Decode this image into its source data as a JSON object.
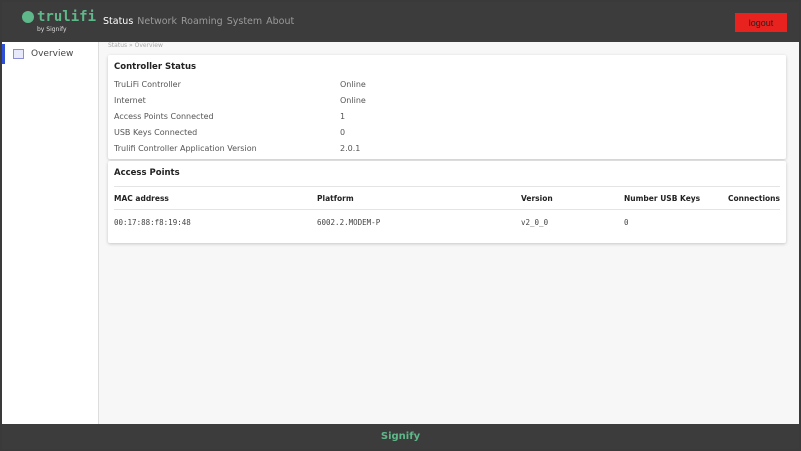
{
  "header": {
    "brand": "trulifi",
    "by": "by Signify",
    "nav": [
      "Status",
      "Network",
      "Roaming",
      "System",
      "About"
    ],
    "logout": "logout"
  },
  "sidebar": {
    "items": [
      {
        "label": "Overview"
      }
    ]
  },
  "breadcrumb": "Status » Overview",
  "controller": {
    "title": "Controller Status",
    "rows": [
      {
        "k": "TruLiFi Controller",
        "v": "Online"
      },
      {
        "k": "Internet",
        "v": "Online"
      },
      {
        "k": "Access Points Connected",
        "v": "1"
      },
      {
        "k": "USB Keys Connected",
        "v": "0"
      },
      {
        "k": "Trulifi Controller Application Version",
        "v": "2.0.1"
      }
    ]
  },
  "access_points": {
    "title": "Access Points",
    "columns": [
      "MAC address",
      "Platform",
      "Version",
      "Number USB Keys",
      "Connections"
    ],
    "rows": [
      [
        "00:17:88:f8:19:48",
        "6002.2.MODEM-P",
        "v2_0_0",
        "0",
        ""
      ]
    ]
  },
  "footer": "Signify",
  "colors": {
    "accent": "#5fb88a",
    "logout": "#e8231f",
    "header": "#3c3c3c"
  }
}
